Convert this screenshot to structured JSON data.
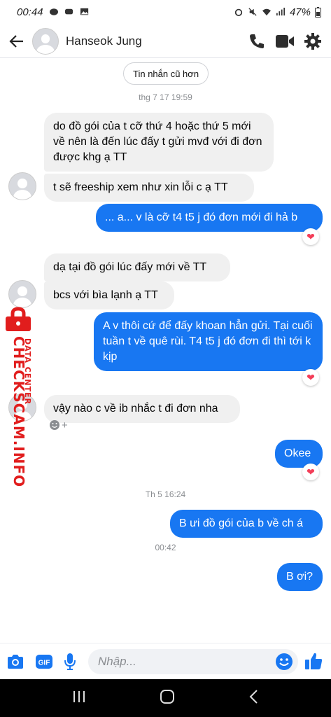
{
  "status_bar": {
    "time": "00:44",
    "battery": "47%"
  },
  "header": {
    "contact_name": "Hanseok Jung"
  },
  "chat": {
    "older_messages_button": "Tin nhắn cũ hơn",
    "timestamp_1": "thg 7 17 19:59",
    "timestamp_2": "Th 5 16:24",
    "timestamp_3": "00:42",
    "messages": [
      {
        "side": "in",
        "text": "do đồ gói của t cỡ thứ 4 hoặc thứ 5 mới về nên là đến lúc đấy t gửi mvđ với đi đơn được khg ạ TT"
      },
      {
        "side": "in",
        "text": "t sẽ freeship xem như xin lỗi c ạ TT"
      },
      {
        "side": "out",
        "text": "... a... v là cỡ t4 t5 j đó đơn mới đi hả b",
        "reaction": "heart"
      },
      {
        "side": "in",
        "text": "dạ tại đồ gói lúc đấy mới về TT"
      },
      {
        "side": "in",
        "text": "bcs với bìa lạnh ạ TT"
      },
      {
        "side": "out",
        "text": "A v thôi cứ để đấy khoan hẳn gửi. Tại cuối tuần t về quê rùi. T4 t5 j đó đơn đi thì tới k kịp",
        "reaction": "heart"
      },
      {
        "side": "in",
        "text": "vậy nào c về ib nhắc t đi đơn nha"
      },
      {
        "side": "out",
        "text": "Okee",
        "reaction": "heart"
      },
      {
        "side": "out",
        "text": "B ưi đồ gói của b về ch á"
      },
      {
        "side": "out",
        "text": "B ơi?"
      }
    ]
  },
  "watermark": {
    "main": "CHECKSCAM.INFO",
    "sub": "DATA CENTER"
  },
  "composer": {
    "placeholder": "Nhập..."
  },
  "colors": {
    "accent": "#1877f2",
    "incoming_bubble": "#f0f0f0",
    "reaction": "#f33e58",
    "watermark": "#e11d1d"
  },
  "icons": [
    "back-arrow-icon",
    "phone-icon",
    "video-icon",
    "gear-icon",
    "camera-icon",
    "gif-icon",
    "microphone-icon",
    "emoji-icon",
    "thumbs-up-icon",
    "heart-icon",
    "add-reaction-icon",
    "recent-apps-icon",
    "home-icon",
    "back-nav-icon"
  ]
}
